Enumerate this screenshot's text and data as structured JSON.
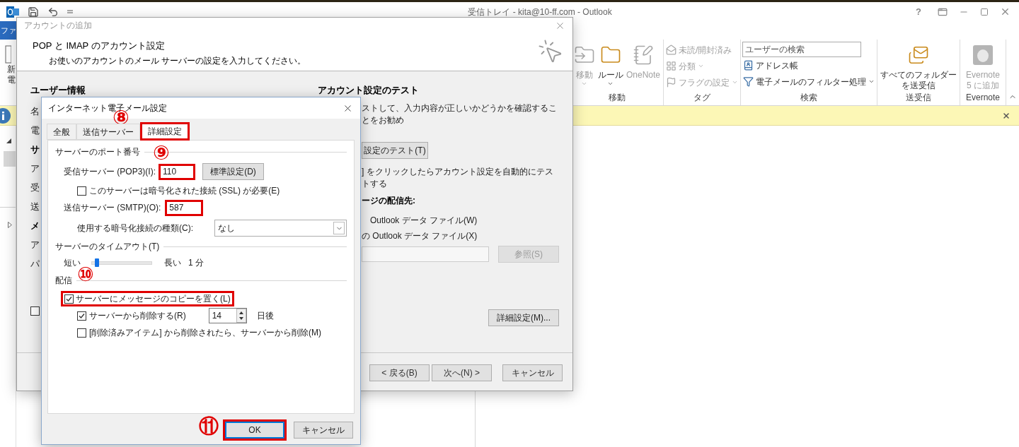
{
  "outlook": {
    "title": "受信トレイ - kita@10-ff.com - Outlook",
    "help": "?",
    "file_tab": "ファ",
    "nav_partial": [
      "新",
      "電"
    ],
    "ribbon_groups": [
      {
        "label": "移動",
        "items": [
          {
            "kind": "large",
            "label": "移動",
            "dropdown": true,
            "disabled": true
          },
          {
            "kind": "large",
            "label": "ルール",
            "dropdown": true,
            "disabled": false
          },
          {
            "kind": "large",
            "label": "OneNote",
            "dropdown": false,
            "disabled": true
          }
        ]
      },
      {
        "label": "タグ",
        "items": [
          {
            "kind": "small",
            "label": "未読/開封済み",
            "dropdown": false,
            "disabled": true
          },
          {
            "kind": "small",
            "label": "分類",
            "dropdown": true,
            "disabled": true
          },
          {
            "kind": "small",
            "label": "フラグの設定",
            "dropdown": true,
            "disabled": true
          }
        ]
      },
      {
        "label": "検索",
        "items": [
          {
            "kind": "search",
            "placeholder": "ユーザーの検索"
          },
          {
            "kind": "small",
            "label": "アドレス帳",
            "dropdown": false,
            "disabled": false
          },
          {
            "kind": "small",
            "label": "電子メールのフィルター処理",
            "dropdown": true,
            "disabled": false
          }
        ]
      },
      {
        "label": "送受信",
        "items": [
          {
            "kind": "large",
            "label": "すべてのフォルダーを送受信",
            "dropdown": false,
            "disabled": false
          }
        ]
      },
      {
        "label": "Evernote",
        "items": [
          {
            "kind": "large",
            "label": "Evernote 5 に追加",
            "dropdown": false,
            "disabled": true
          }
        ]
      }
    ]
  },
  "account_dialog": {
    "title": "アカウントの追加",
    "heading": "POP と IMAP のアカウント設定",
    "subtitle": "お使いのアカウントのメール サーバーの設定を入力してください。",
    "left_header": "ユーザー情報",
    "left_labels": [
      {
        "kind": "label",
        "text": "名"
      },
      {
        "kind": "label",
        "text": "電"
      },
      {
        "kind": "header",
        "text": "サ"
      },
      {
        "kind": "label",
        "text": "ア"
      },
      {
        "kind": "label",
        "text": "受"
      },
      {
        "kind": "label",
        "text": "送"
      },
      {
        "kind": "header",
        "text": "メ"
      },
      {
        "kind": "label",
        "text": "ア"
      },
      {
        "kind": "label",
        "text": "パ"
      }
    ],
    "left_checkbox": {
      "checked": false
    },
    "right_header": "アカウント設定のテスト",
    "test_text": "ストして、入力内容が正しいかどうかを確認することをお勧め",
    "test_button": "設定のテスト(T)",
    "auto_test_text": "] をクリックしたらアカウント設定を自動的にテストする",
    "delivery_header": "ージの配信先:",
    "delivery_options": [
      "Outlook データ ファイル(W)",
      "の Outlook データ ファイル(X)"
    ],
    "browse_button": {
      "label": "参照(S)",
      "disabled": true
    },
    "more_settings_button": "詳細設定(M)...",
    "footer_buttons": [
      "< 戻る(B)",
      "次へ(N) >",
      "キャンセル"
    ]
  },
  "mail_settings_dialog": {
    "title": "インターネット電子メール設定",
    "tabs": [
      {
        "label": "全般",
        "selected": false,
        "highlighted": false
      },
      {
        "label": "送信サーバー",
        "selected": false,
        "highlighted": false
      },
      {
        "label": "詳細設定",
        "selected": true,
        "highlighted": true
      }
    ],
    "port_group": "サーバーのポート番号",
    "incoming": {
      "label": "受信サーバー (POP3)(I):",
      "value": "110",
      "highlighted": true
    },
    "default_button": "標準設定(D)",
    "ssl": {
      "label": "このサーバーは暗号化された接続 (SSL) が必要(E)",
      "checked": false
    },
    "outgoing": {
      "label": "送信サーバー (SMTP)(O):",
      "value": "587",
      "highlighted": true
    },
    "encryption": {
      "label": "使用する暗号化接続の種類(C):",
      "value": "なし"
    },
    "timeout_group": "サーバーのタイムアウト(T)",
    "timeout": {
      "min_label": "短い",
      "max_label": "長い",
      "reading": "1 分",
      "level": 0.08
    },
    "delivery_group": "配信",
    "delivery": {
      "label": "サーバーにメッセージのコピーを置く(L)",
      "checked": true,
      "highlighted": true,
      "children": [
        {
          "kind": "spinner",
          "label": "サーバーから削除する(R)",
          "checked": true,
          "value": "14",
          "unit": "日後"
        },
        {
          "kind": "checkbox",
          "label": "[削除済みアイテム] から削除されたら、サーバーから削除(M)",
          "checked": false
        }
      ]
    },
    "buttons": [
      {
        "label": "OK",
        "default": true,
        "highlighted": true
      },
      {
        "label": "キャンセル",
        "default": false,
        "highlighted": false
      }
    ]
  },
  "annotations": [
    "⑧",
    "⑨",
    "⑩",
    "⑪"
  ]
}
